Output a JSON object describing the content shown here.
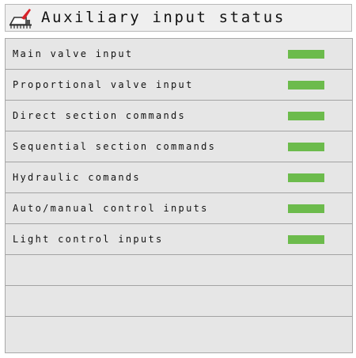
{
  "header": {
    "title": "Auxiliary input status",
    "icon": "sprayer-tank-icon"
  },
  "colors": {
    "status_ok": "#6cbb4c",
    "header_bg": "#efefef",
    "list_bg": "#e6e6e6",
    "icon_accent": "#d8232a"
  },
  "inputs": [
    {
      "label": "Main valve input",
      "status": "active"
    },
    {
      "label": "Proportional valve input",
      "status": "active"
    },
    {
      "label": "Direct section commands",
      "status": "active"
    },
    {
      "label": "Sequential section commands",
      "status": "active"
    },
    {
      "label": "Hydraulic comands",
      "status": "active"
    },
    {
      "label": "Auto/manual control inputs",
      "status": "active"
    },
    {
      "label": "Light control inputs",
      "status": "active"
    }
  ]
}
